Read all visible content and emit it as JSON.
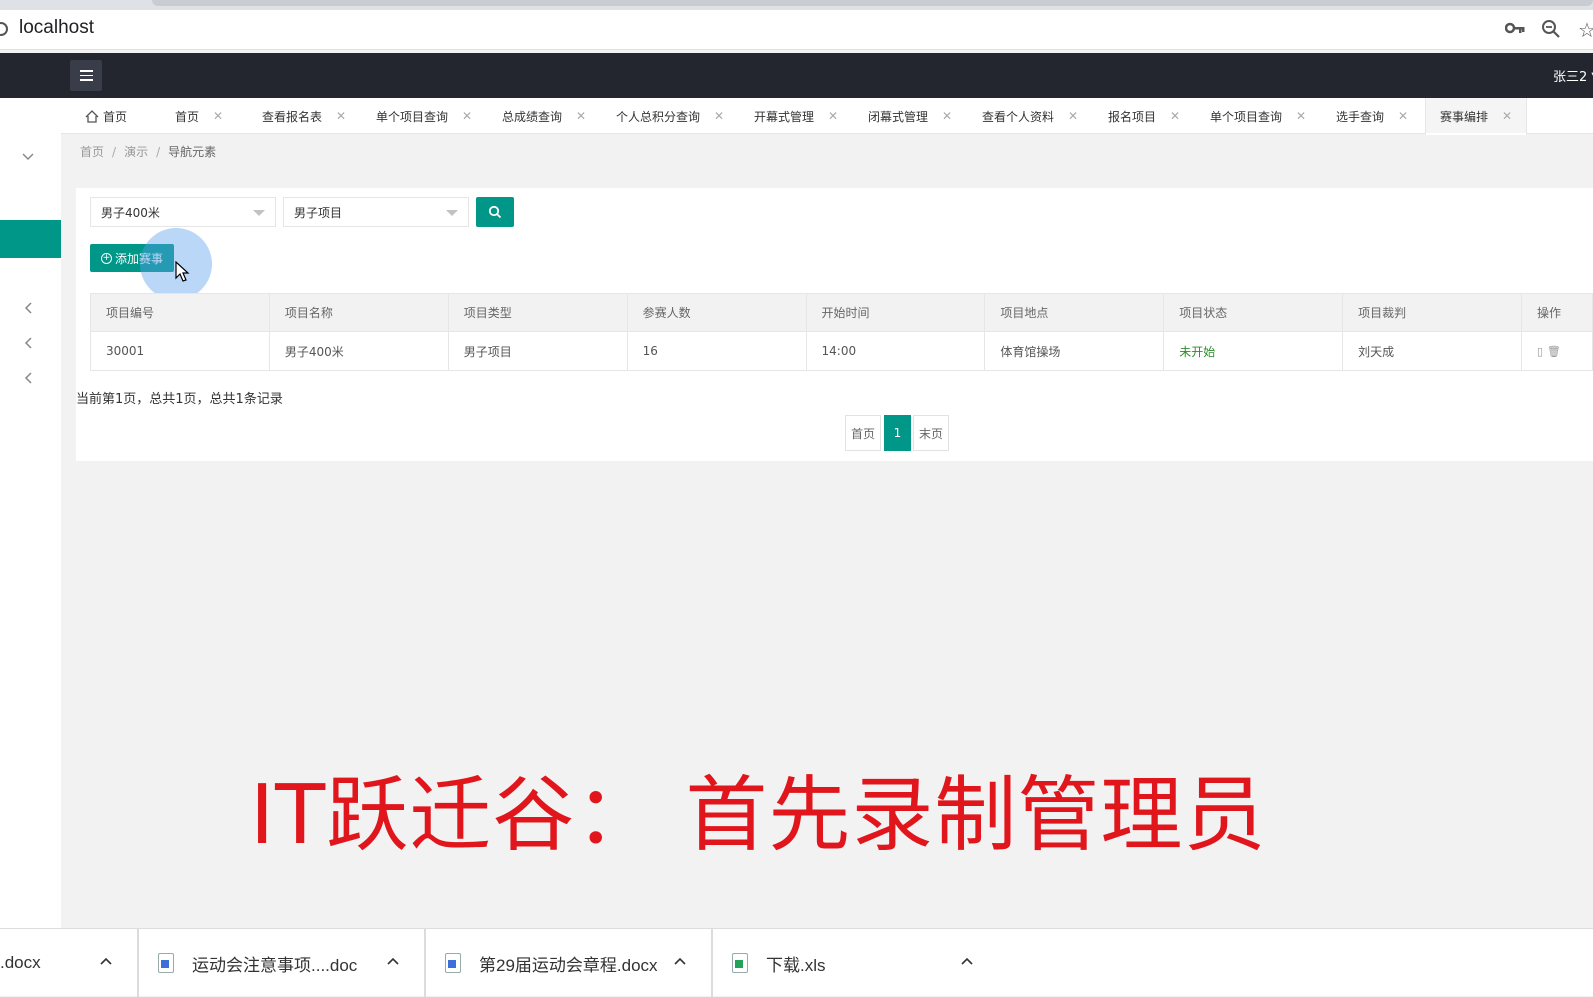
{
  "browser": {
    "url": "localhost"
  },
  "header": {
    "user": "张三2 ▼"
  },
  "tabs": [
    {
      "label": "首页",
      "closable": false
    },
    {
      "label": "首页",
      "closable": true
    },
    {
      "label": "查看报名表",
      "closable": true
    },
    {
      "label": "单个项目查询",
      "closable": true
    },
    {
      "label": "总成绩查询",
      "closable": true
    },
    {
      "label": "个人总积分查询",
      "closable": true
    },
    {
      "label": "开幕式管理",
      "closable": true
    },
    {
      "label": "闭幕式管理",
      "closable": true
    },
    {
      "label": "查看个人资料",
      "closable": true
    },
    {
      "label": "报名项目",
      "closable": true
    },
    {
      "label": "单个项目查询",
      "closable": true
    },
    {
      "label": "选手查询",
      "closable": true
    },
    {
      "label": "赛事编排",
      "closable": true,
      "active": true
    }
  ],
  "breadcrumb": [
    "首页",
    "演示",
    "导航元素"
  ],
  "filters": {
    "event": "男子400米",
    "category": "男子项目"
  },
  "add_button": "添加赛事",
  "table": {
    "headers": [
      "项目编号",
      "项目名称",
      "项目类型",
      "参赛人数",
      "开始时间",
      "项目地点",
      "项目状态",
      "项目裁判",
      "操作"
    ],
    "rows": [
      [
        "30001",
        "男子400米",
        "男子项目",
        "16",
        "14:00",
        "体育馆操场",
        "未开始",
        "刘天成",
        ""
      ]
    ]
  },
  "pagination": {
    "info": "当前第1页，总共1页，总共1条记录",
    "first": "首页",
    "current": "1",
    "last": "末页"
  },
  "caption": "IT跃迁谷：  首先录制管理员",
  "downloads": [
    {
      "name": ".docx",
      "type": "doc"
    },
    {
      "name": "运动会注意事项....doc",
      "type": "doc"
    },
    {
      "name": "第29届运动会章程.docx",
      "type": "doc"
    },
    {
      "name": "下载.xls",
      "type": "xls"
    }
  ],
  "colors": {
    "primary": "#009688",
    "header": "#23262e",
    "caption": "#e0161c",
    "status_green": "#2e8b2e"
  }
}
